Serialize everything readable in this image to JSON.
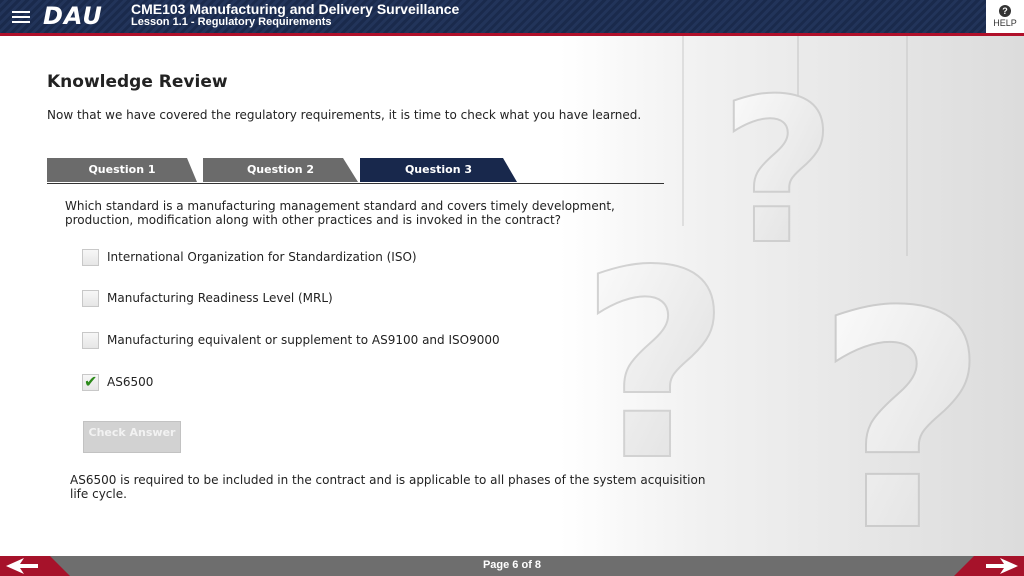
{
  "header": {
    "logo": "DAU",
    "course_title": "CME103 Manufacturing and Delivery Surveillance",
    "lesson_title": "Lesson 1.1 - Regulatory Requirements",
    "help_label": "HELP"
  },
  "main": {
    "heading": "Knowledge Review",
    "intro": "Now that we have covered the regulatory requirements, it is time to check what you have learned.",
    "tabs": [
      {
        "label": "Question 1"
      },
      {
        "label": "Question 2"
      },
      {
        "label": "Question 3"
      }
    ],
    "active_tab": "Question 3",
    "question": "Which standard is a manufacturing management standard and covers timely development, production, modification along with other practices and is invoked in the contract?",
    "options": [
      {
        "label": "International Organization for Standardization (ISO)",
        "checked": false
      },
      {
        "label": "Manufacturing Readiness Level (MRL)",
        "checked": false
      },
      {
        "label": "Manufacturing equivalent or supplement to AS9100 and ISO9000",
        "checked": false
      },
      {
        "label": "AS6500",
        "checked": true
      }
    ],
    "check_button": "Check Answer",
    "feedback": "AS6500 is required to be included in the contract and is applicable to all phases of the system acquisition life cycle."
  },
  "footer": {
    "page_indicator": "Page 6 of 8"
  },
  "colors": {
    "header_navy": "#1a2a4c",
    "accent_red": "#b0102a",
    "active_tab": "#18284c",
    "inactive_tab": "#6b6b6b",
    "checkmark_green": "#2c8a1a",
    "footer_gray": "#6e6e6e"
  },
  "icons": [
    "menu-icon",
    "help-icon",
    "prev-arrow-icon",
    "next-arrow-icon",
    "checkmark-icon",
    "question-mark-decoration"
  ]
}
